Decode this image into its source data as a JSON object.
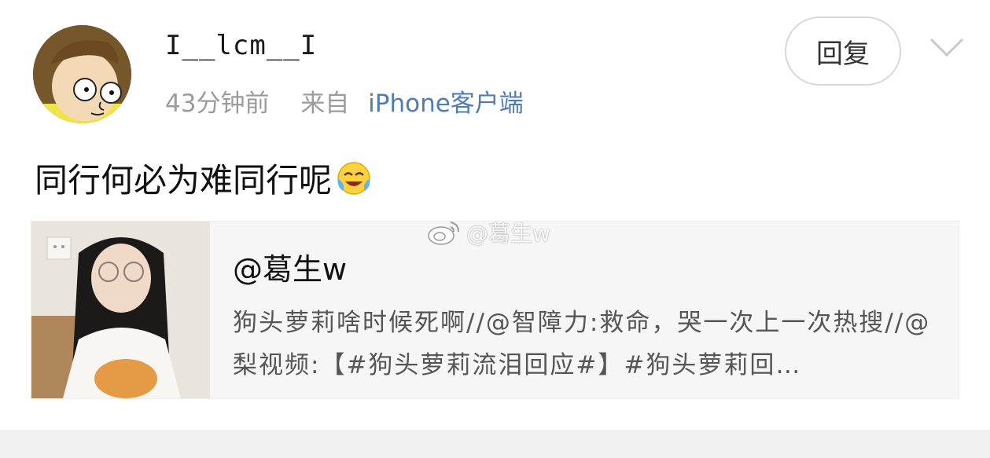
{
  "post": {
    "username": "I__lcm__I",
    "time": "43分钟前",
    "source_label": "来自",
    "client": "iPhone客户端",
    "reply_label": "回复",
    "text": "同行何必为难同行呢",
    "emoji": "crying-laughing-emoji"
  },
  "quote": {
    "author": "@葛生w",
    "excerpt": "狗头萝莉啥时候死啊//@智障力:救命，哭一次上一次热搜//@梨视频:【#狗头萝莉流泪回应#】#狗头萝莉回…"
  },
  "watermark": {
    "text": "@葛生w",
    "icon": "weibo-logo-icon"
  },
  "colors": {
    "link": "#4f7cb3",
    "meta": "#9b9b9b",
    "card_bg": "#f6f6f6"
  }
}
